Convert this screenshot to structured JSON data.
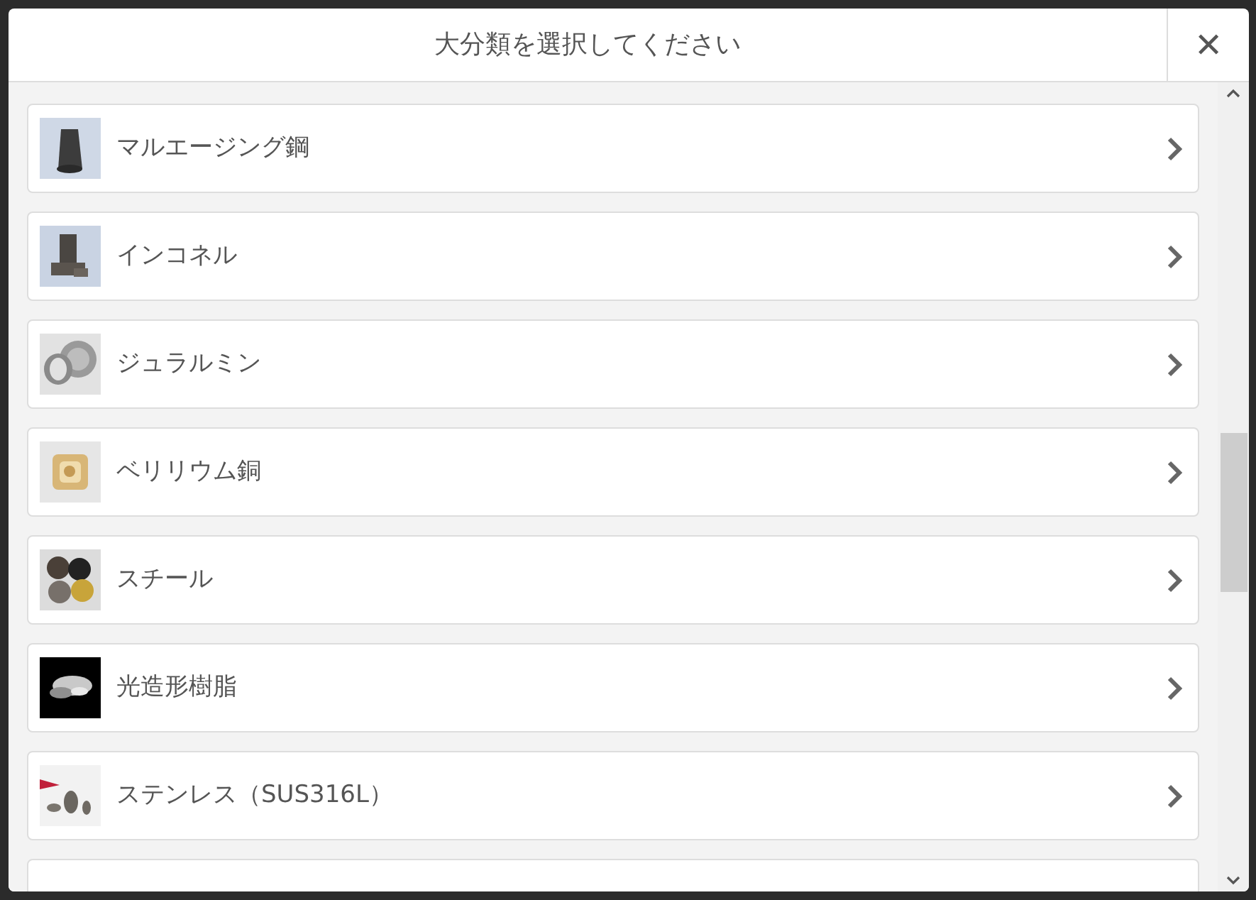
{
  "dialog": {
    "title": "大分類を選択してください",
    "close": "✕"
  },
  "items": [
    {
      "label": "マルエージング鋼",
      "kind": "picture"
    },
    {
      "label": "インコネル",
      "kind": "picture"
    },
    {
      "label": "ジュラルミン",
      "kind": "picture"
    },
    {
      "label": "ベリリウム銅",
      "kind": "picture"
    },
    {
      "label": "スチール",
      "kind": "picture"
    },
    {
      "label": "光造形樹脂",
      "kind": "picture"
    },
    {
      "label": "ステンレス（SUS316L）",
      "kind": "picture"
    }
  ]
}
